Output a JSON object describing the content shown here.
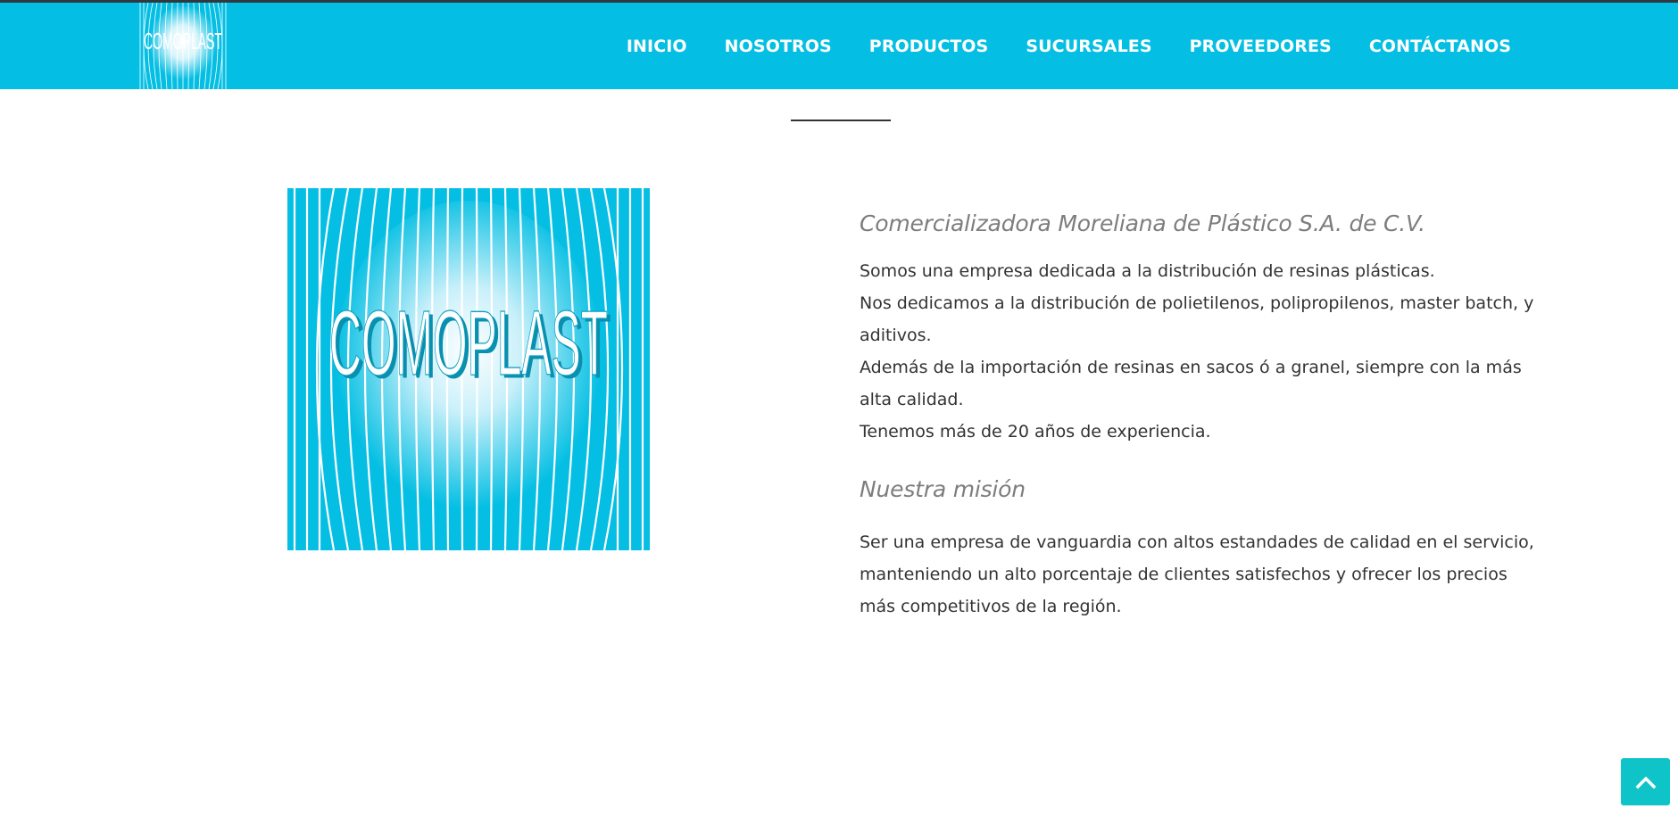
{
  "header": {
    "logo_text": "COMOPLAST",
    "nav": [
      {
        "label": "INICIO"
      },
      {
        "label": "NOSOTROS"
      },
      {
        "label": "PRODUCTOS"
      },
      {
        "label": "SUCURSALES"
      },
      {
        "label": "PROVEEDORES"
      },
      {
        "label": "CONTÁCTANOS"
      }
    ]
  },
  "main": {
    "logo_text": "COMOPLAST",
    "company_name": "Comercializadora Moreliana de Plástico S.A. de C.V.",
    "about_paragraphs": [
      "Somos una empresa dedicada a la distribución de resinas plásticas.",
      "Nos dedicamos a la distribución de polietilenos, polipropilenos, master batch, y aditivos.",
      "Además de la importación de resinas en sacos ó a granel, siempre con la más alta calidad.",
      "Tenemos más de 20 años de experiencia."
    ],
    "mission_heading": "Nuestra misión",
    "mission_text": "Ser una empresa de vanguardia con altos estandades de calidad en el servicio, manteniendo un alto porcentaje de clientes satisfechos y ofrecer los precios más competitivos de la región."
  },
  "scroll_top": {
    "icon": "chevron-up-icon"
  },
  "colors": {
    "brand": "#04bfe3",
    "scroll_button": "#0ec4c8",
    "heading": "#7d7d7d",
    "text": "#333333"
  }
}
